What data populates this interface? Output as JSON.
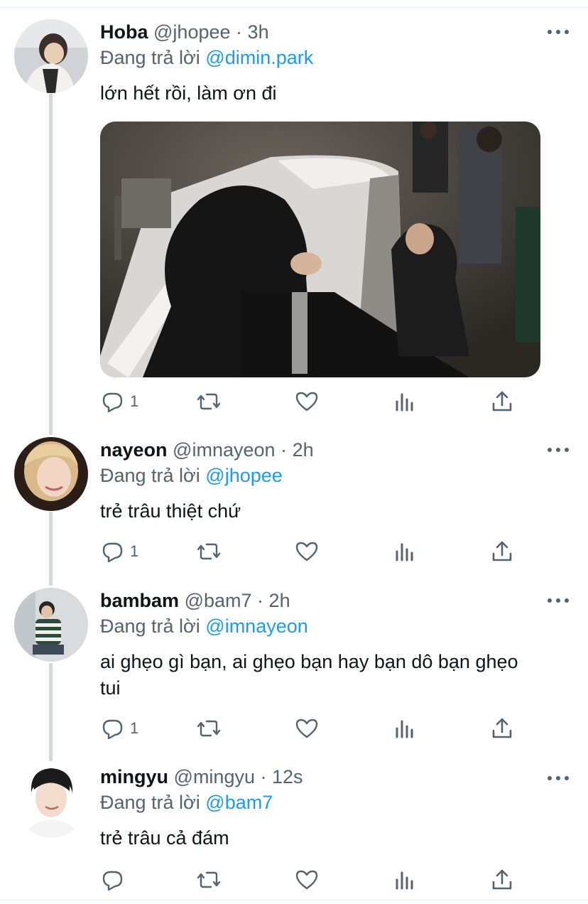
{
  "tweets": [
    {
      "name": "Hoba",
      "handle": "@jhopee",
      "time": "3h",
      "replying_label": "Đang trả lời",
      "replying_to": "@dimin.park",
      "text": "lớn hết rồi, làm ơn đi",
      "reply_count": "1",
      "has_media": true
    },
    {
      "name": "nayeon",
      "handle": "@imnayeon",
      "time": "2h",
      "replying_label": "Đang trả lời",
      "replying_to": "@jhopee",
      "text": "trẻ trâu thiệt chứ",
      "reply_count": "1"
    },
    {
      "name": "bambam",
      "handle": "@bam7",
      "time": "2h",
      "replying_label": "Đang trả lời",
      "replying_to": "@imnayeon",
      "text": "ai ghẹo gì bạn, ai ghẹo bạn hay bạn dô bạn ghẹo tui",
      "reply_count": "1"
    },
    {
      "name": "mingyu",
      "handle": "@mingyu",
      "time": "12s",
      "replying_label": "Đang trả lời",
      "replying_to": "@bam7",
      "text": "trẻ trâu cả đám",
      "reply_count": ""
    }
  ],
  "separator": "·",
  "icons": {
    "reply": "reply-icon",
    "retweet": "retweet-icon",
    "like": "heart-icon",
    "analytics": "analytics-icon",
    "share": "share-icon",
    "more": "more-icon"
  },
  "colors": {
    "accent": "#1d9bf0",
    "secondary_text": "#536471",
    "thread_line": "#cfd9de"
  }
}
